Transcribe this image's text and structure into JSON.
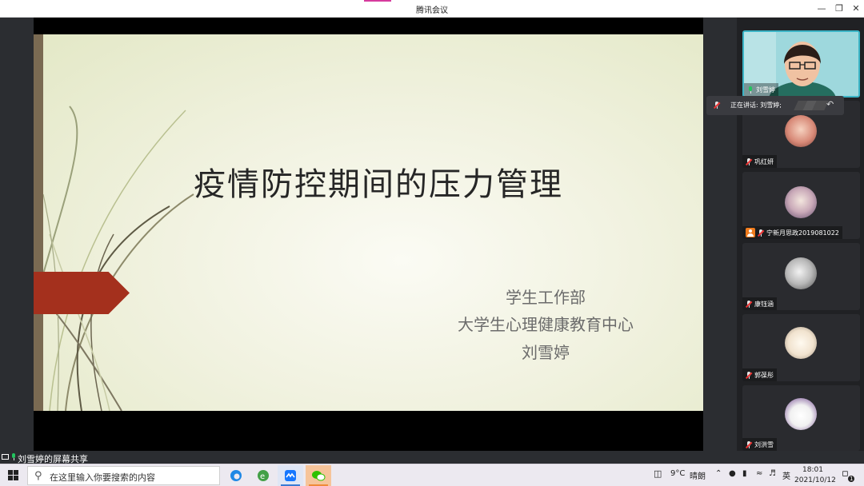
{
  "window": {
    "title": "腾讯会议"
  },
  "slide": {
    "title": "疫情防控期间的压力管理",
    "lines": [
      "学生工作部",
      "大学生心理健康教育中心",
      "刘雪婷"
    ]
  },
  "speaking": {
    "text": "正在讲话: 刘雪婷;"
  },
  "participants": [
    {
      "name": "刘雪婷",
      "mic": "on",
      "avatar": "camera-feed"
    },
    {
      "name": "巩红妍",
      "mic": "muted",
      "avatar": "avatar-photo"
    },
    {
      "name": "宁新月思政2019081022",
      "mic": "muted",
      "avatar": "avatar-photo",
      "host_badge": true
    },
    {
      "name": "康钰涵",
      "mic": "muted",
      "avatar": "avatar-photo"
    },
    {
      "name": "郭葆彤",
      "mic": "muted",
      "avatar": "avatar-photo"
    },
    {
      "name": "刘洪雪",
      "mic": "muted",
      "avatar": "avatar-photo"
    }
  ],
  "share_caption": "刘雪婷的屏幕共享",
  "taskbar": {
    "search_placeholder": "在这里输入你要搜索的内容",
    "weather_temp": "9°C",
    "weather_desc": "晴朗",
    "ime": "英",
    "time": "18:01",
    "date": "2021/10/12",
    "notification_count": "1"
  },
  "colors": {
    "accent": "#d63a9d",
    "slide_arrow": "#a4301d",
    "speaking_green": "#22c55e"
  }
}
